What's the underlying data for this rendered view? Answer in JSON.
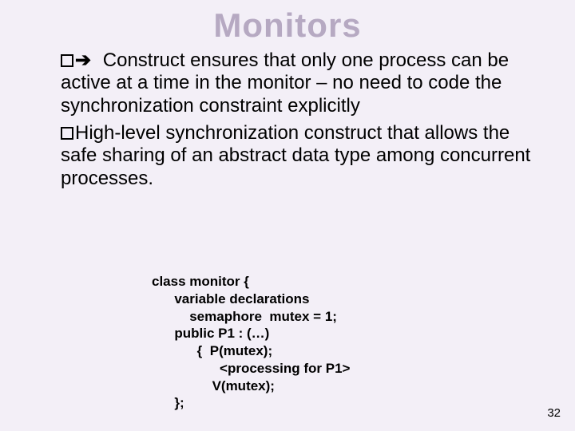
{
  "title": "Monitors",
  "bullets": [
    {
      "marker": "arrow",
      "text": " Construct ensures that only one process can be active at a time in the monitor – no need to code the synchronization constraint explicitly"
    },
    {
      "marker": "square",
      "text": "High-level synchronization construct that allows the safe sharing of an abstract data type among concurrent processes."
    }
  ],
  "code_lines": [
    "class monitor {",
    "      variable declarations",
    "          semaphore  mutex = 1;",
    "      public P1 : (…)",
    "            {  P(mutex);",
    "                  <processing for P1>",
    "                V(mutex);",
    "      };"
  ],
  "page_number": "32"
}
